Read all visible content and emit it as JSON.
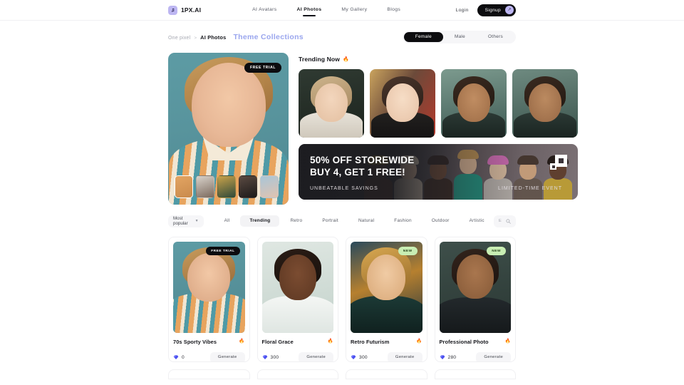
{
  "nav": {
    "brand": "1PX.AI",
    "brand_icon": "music-note-square-icon",
    "links": [
      {
        "label": "AI Avatars",
        "active": false
      },
      {
        "label": "AI Photos",
        "active": true
      },
      {
        "label": "My Gallery",
        "active": false
      },
      {
        "label": "Blogs",
        "active": false
      }
    ],
    "login_label": "Login",
    "signup_label": "Signup",
    "signup_arrow_icon": "arrow-up-right-icon"
  },
  "breadcrumb": {
    "root": "One pixel",
    "separator": ">",
    "current": "AI Photos",
    "page_title": "Theme Collections"
  },
  "gender_toggle": {
    "options": [
      {
        "label": "Female",
        "active": true
      },
      {
        "label": "Male",
        "active": false
      },
      {
        "label": "Others",
        "active": false
      }
    ]
  },
  "hero": {
    "badge": "FREE TRIAL",
    "thumbnails": [
      {
        "name": "blonde-portrait",
        "selected": true
      },
      {
        "name": "bridal-portrait",
        "selected": false
      },
      {
        "name": "emerald-portrait",
        "selected": false
      },
      {
        "name": "dark-suit-portrait",
        "selected": false
      },
      {
        "name": "pastel-portrait",
        "selected": false
      }
    ]
  },
  "trending": {
    "title": "Trending Now",
    "flame_icon": "🔥",
    "cards": [
      {
        "name": "bridal-veil-portrait"
      },
      {
        "name": "red-lips-portrait"
      },
      {
        "name": "teal-tone-portrait"
      },
      {
        "name": "fourth-portrait-clipped"
      }
    ]
  },
  "promo": {
    "headline_line1": "50% OFF STOREWIDE",
    "headline_line2": "BUY 4, GET 1 FREE!",
    "sub_left": "UNBEATABLE SAVINGS",
    "sub_right": "LIMITED-TIME EVENT",
    "logo_icon": "nested-squares-logo-icon"
  },
  "filters": {
    "sort_label": "Most popular",
    "chevron_icon": "chevron-down-icon",
    "categories": [
      {
        "label": "All",
        "active": false
      },
      {
        "label": "Trending",
        "active": true
      },
      {
        "label": "Retro",
        "active": false
      },
      {
        "label": "Portrait",
        "active": false
      },
      {
        "label": "Natural",
        "active": false
      },
      {
        "label": "Fashion",
        "active": false
      },
      {
        "label": "Outdoor",
        "active": false
      },
      {
        "label": "Artistic",
        "active": false
      }
    ],
    "search_placeholder": "Enter your keywords...",
    "search_value": "",
    "search_icon": "search-icon"
  },
  "cards": [
    {
      "title": "70s Sporty Vibes",
      "badge": "FREE TRIAL",
      "badge_style": "dark",
      "credits": "0",
      "credit_icon": "gem-icon",
      "flame_icon": "🔥",
      "generate_label": "Generate"
    },
    {
      "title": "Floral Grace",
      "badge": "",
      "badge_style": "none",
      "credits": "300",
      "credit_icon": "gem-icon",
      "flame_icon": "🔥",
      "generate_label": "Generate"
    },
    {
      "title": "Retro Futurism",
      "badge": "NEW",
      "badge_style": "new",
      "credits": "300",
      "credit_icon": "gem-icon",
      "flame_icon": "🔥",
      "generate_label": "Generate"
    },
    {
      "title": "Professional Photo",
      "badge": "NEW",
      "badge_style": "new",
      "credits": "280",
      "credit_icon": "gem-icon",
      "flame_icon": "🔥",
      "generate_label": "Generate"
    }
  ],
  "colors": {
    "accent_lavender": "#bdb6f2",
    "title_blue": "#9aa6ee",
    "dark": "#0c0c0f",
    "badge_green": "#c8eeb3",
    "flame_red": "#f04a2a"
  }
}
